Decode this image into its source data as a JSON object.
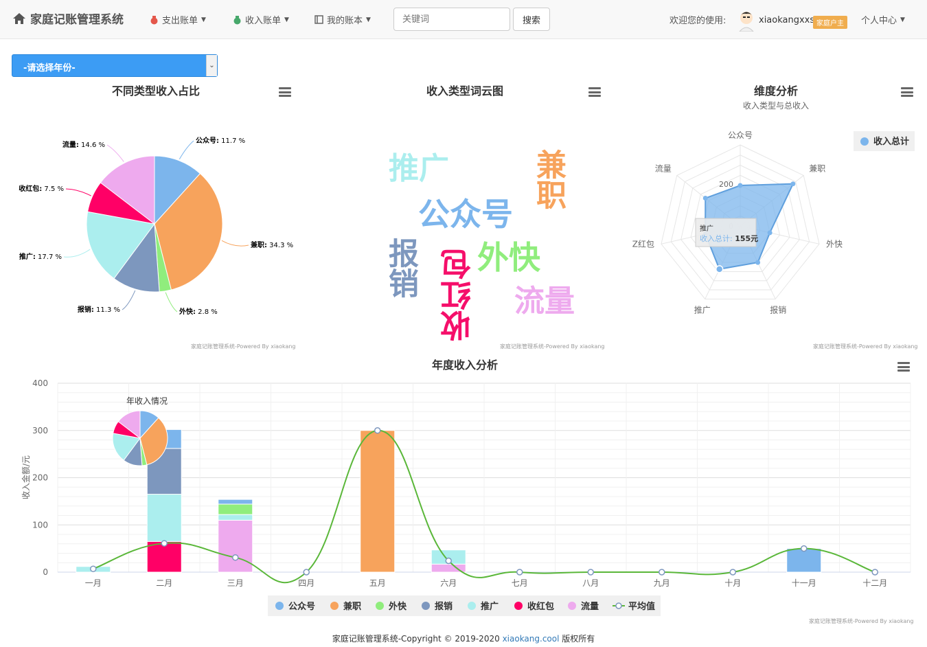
{
  "nav": {
    "brand": "家庭记账管理系统",
    "expense_menu": "支出账单",
    "income_menu": "收入账单",
    "my_bills_menu": "我的账本",
    "search_placeholder": "关键词",
    "search_button": "搜索",
    "welcome": "欢迎您的使用:",
    "username": "xiaokangxxs",
    "role_badge": "家庭户主",
    "personal_center": "个人中心"
  },
  "year_select": {
    "selected": "-请选择年份-"
  },
  "colors": {
    "公众号": "#7cb5ec",
    "兼职": "#f7a35c",
    "外快": "#90ed7d",
    "报销": "#8085e9",
    "推广": "#abeeee",
    "收红包": "#ff0066",
    "流量": "#eeaaee",
    "平均值": "#5ab739",
    "primary": "#3c9cf4"
  },
  "pie_chart": {
    "title": "不同类型收入占比",
    "credit": "家庭记账管理系统-Powered By xiaokang",
    "labels": [
      "公众号: 11.7 %",
      "兼职: 34.3 %",
      "外快: 2.8 %",
      "报销: 11.3 %",
      "推广: 17.7 %",
      "收红包: 7.5 %",
      "流量: 14.6 %"
    ]
  },
  "wordcloud": {
    "title": "收入类型词云图",
    "credit": "家庭记账管理系统-Powered By xiaokang",
    "words": [
      "推广",
      "兼职",
      "公众号",
      "报销",
      "收红包",
      "外快",
      "流量"
    ]
  },
  "radar": {
    "title": "维度分析",
    "subtitle": "收入类型与总收入",
    "legend": "收入总计",
    "axes": [
      "公众号",
      "兼职",
      "外快",
      "报销",
      "推广",
      "Z红包",
      "流量"
    ],
    "tick_labels": [
      "200",
      "0"
    ],
    "tooltip_title": "推广",
    "tooltip_label": "收入总计:",
    "tooltip_value": "155元",
    "credit": "家庭记账管理系统-Powered By xiaokang"
  },
  "bar_chart": {
    "title": "年度收入分析",
    "ylabel": "收入金额/元",
    "yticks": [
      "400",
      "300",
      "200",
      "100",
      "0"
    ],
    "inset_title": "年收入情况",
    "credit": "家庭记账管理系统-Powered By xiaokang"
  },
  "chart_data": [
    {
      "type": "pie",
      "title": "不同类型收入占比",
      "categories": [
        "公众号",
        "兼职",
        "外快",
        "报销",
        "推广",
        "收红包",
        "流量"
      ],
      "values": [
        11.7,
        34.3,
        2.8,
        11.3,
        17.7,
        7.5,
        14.6
      ]
    },
    {
      "type": "radar",
      "title": "维度分析",
      "subtitle": "收入类型与总收入",
      "categories": [
        "公众号",
        "兼职",
        "外快",
        "报销",
        "推广",
        "收红包",
        "流量"
      ],
      "series": [
        {
          "name": "收入总计",
          "values": [
            100,
            300,
            25,
            100,
            155,
            65,
            130
          ]
        }
      ]
    },
    {
      "type": "bar",
      "stacked": true,
      "title": "年度收入分析",
      "ylabel": "收入金额/元",
      "ylim": [
        0,
        400
      ],
      "categories": [
        "一月",
        "二月",
        "三月",
        "四月",
        "五月",
        "六月",
        "七月",
        "八月",
        "九月",
        "十月",
        "十一月",
        "十二月"
      ],
      "series": [
        {
          "name": "公众号",
          "values": [
            0,
            40,
            10,
            0,
            0,
            0,
            0,
            0,
            0,
            0,
            50,
            0
          ]
        },
        {
          "name": "兼职",
          "values": [
            0,
            0,
            0,
            0,
            300,
            0,
            0,
            0,
            0,
            0,
            0,
            0
          ]
        },
        {
          "name": "外快",
          "values": [
            0,
            0,
            22,
            0,
            0,
            0,
            0,
            0,
            0,
            0,
            0,
            0
          ]
        },
        {
          "name": "报销",
          "values": [
            0,
            97,
            0,
            0,
            0,
            0,
            0,
            0,
            0,
            0,
            0,
            0
          ]
        },
        {
          "name": "推广",
          "values": [
            12,
            100,
            12,
            0,
            0,
            30,
            0,
            0,
            0,
            0,
            0,
            0
          ]
        },
        {
          "name": "收红包",
          "values": [
            0,
            65,
            0,
            0,
            0,
            0,
            0,
            0,
            0,
            0,
            0,
            0
          ]
        },
        {
          "name": "流量",
          "values": [
            0,
            0,
            110,
            0,
            0,
            17,
            0,
            0,
            0,
            0,
            0,
            0
          ]
        },
        {
          "name": "平均值",
          "type": "spline",
          "values": [
            7,
            61,
            31,
            0,
            300,
            24,
            0,
            0,
            0,
            0,
            50,
            0
          ]
        }
      ]
    }
  ],
  "footer": {
    "text": "家庭记账管理系统-Copyright © 2019-2020",
    "link": "xiaokang.cool",
    "suffix": "版权所有"
  }
}
